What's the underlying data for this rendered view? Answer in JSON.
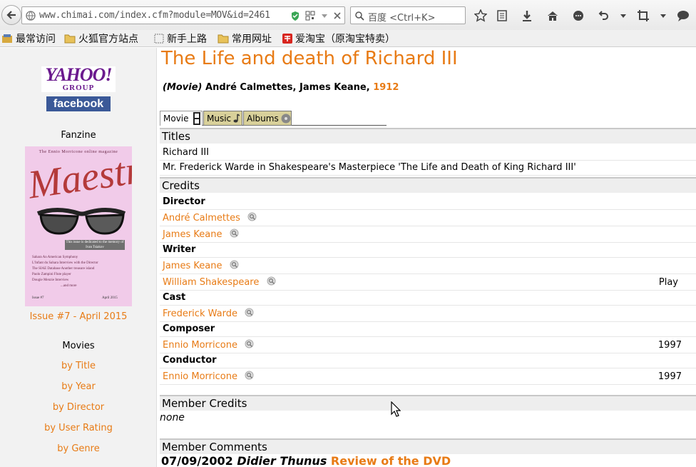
{
  "browser": {
    "url": "www.chimai.com/index.cfm?module=MOV&id=2461",
    "search_placeholder": "百度 <Ctrl+K>"
  },
  "bookmarks": [
    {
      "label": "最常访问"
    },
    {
      "label": "火狐官方站点"
    },
    {
      "label": "新手上路"
    },
    {
      "label": "常用网址"
    },
    {
      "label": "爱淘宝（原淘宝特卖）"
    }
  ],
  "sidebar": {
    "yahoo": "YAHOO!",
    "yahoo_group": "GROUP",
    "facebook": "facebook",
    "fanzine": "Fanzine",
    "magazine": {
      "top": "The Ennio Morricone online magazine",
      "title": "Maestro",
      "dedication": "This issue is dedicated to the memory of Ivan Tsiakov",
      "lines": [
        "Sahara An American Symphony",
        "L'Infant du Sahara Interview with the Director",
        "The SIAE Database Another treasure island",
        "Paolo Zampini Flute player",
        "Dougie Menzie Interview",
        "...and more"
      ],
      "issue": "Issue #7",
      "date": "April 2015"
    },
    "issue_link": "Issue #7 - April 2015",
    "movies_heading": "Movies",
    "links": [
      "by Title",
      "by Year",
      "by Director",
      "by User Rating",
      "by Genre"
    ]
  },
  "movie": {
    "title": "The Life and death of Richard III",
    "type": "(Movie)",
    "directors": "André Calmettes, James Keane,",
    "year": "1912"
  },
  "tabs": [
    "Movie",
    "Music",
    "Albums"
  ],
  "sections": {
    "titles": "Titles",
    "credits": "Credits",
    "member_credits": "Member Credits",
    "member_comments": "Member Comments"
  },
  "titles": [
    "Richard III",
    "Mr. Frederick Warde in Shakespeare's Masterpiece 'The Life and Death of King Richard III'"
  ],
  "credits": {
    "director_role": "Director",
    "director_1": "André Calmettes",
    "director_2": "James Keane",
    "writer_role": "Writer",
    "writer_1": "James Keane",
    "writer_2": "William Shakespeare",
    "writer_2_note": "Play",
    "cast_role": "Cast",
    "cast_1": "Frederick Warde",
    "composer_role": "Composer",
    "composer_1": "Ennio Morricone",
    "composer_1_year": "1997",
    "conductor_role": "Conductor",
    "conductor_1": "Ennio Morricone",
    "conductor_1_year": "1997"
  },
  "member_credits_value": "none",
  "comment": {
    "date": "07/09/2002",
    "author": "Didier Thunus",
    "link": "Review of the DVD"
  }
}
